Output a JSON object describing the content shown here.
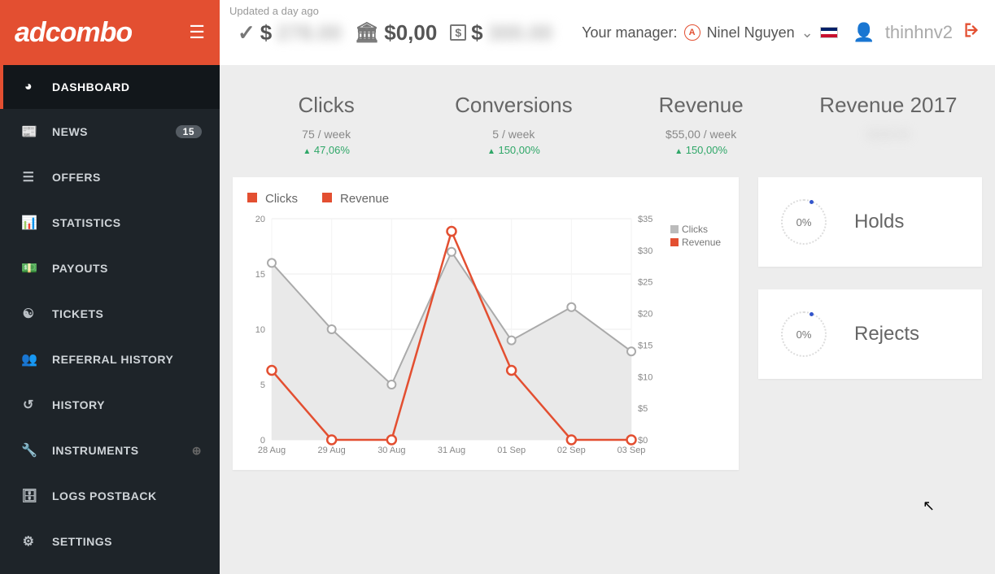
{
  "header": {
    "logo": "adcombo",
    "updated": "Updated a day ago",
    "balance1": "278.00",
    "balance2": "$0,00",
    "balance3": "300.00",
    "manager_label": "Your manager:",
    "manager_initial": "A",
    "manager_name": "Ninel Nguyen",
    "username": "thinhnv2"
  },
  "sidebar": {
    "items": [
      {
        "label": "DASHBOARD"
      },
      {
        "label": "NEWS",
        "badge": "15"
      },
      {
        "label": "OFFERS"
      },
      {
        "label": "STATISTICS"
      },
      {
        "label": "PAYOUTS"
      },
      {
        "label": "TICKETS"
      },
      {
        "label": "REFERRAL HISTORY"
      },
      {
        "label": "HISTORY"
      },
      {
        "label": "INSTRUMENTS"
      },
      {
        "label": "LOGS POSTBACK"
      },
      {
        "label": "SETTINGS"
      }
    ]
  },
  "stats": {
    "clicks": {
      "title": "Clicks",
      "sub": "75 / week",
      "pct": "47,06%"
    },
    "conversions": {
      "title": "Conversions",
      "sub": "5 / week",
      "pct": "150,00%"
    },
    "revenue": {
      "title": "Revenue",
      "sub": "$55,00 / week",
      "pct": "150,00%"
    },
    "revenue_year": {
      "title": "Revenue 2017",
      "value": "$190.00"
    }
  },
  "side_cards": {
    "holds": {
      "pct": "0%",
      "label": "Holds"
    },
    "rejects": {
      "pct": "0%",
      "label": "Rejects"
    }
  },
  "chart_legend": {
    "a": "Clicks",
    "b": "Revenue",
    "mini_a": "Clicks",
    "mini_b": "Revenue"
  },
  "chart_axes": {
    "y_left": [
      "20",
      "15",
      "10",
      "5",
      "0"
    ],
    "y_right": [
      "$35",
      "$30",
      "$25",
      "$20",
      "$15",
      "$10",
      "$5",
      "$0"
    ]
  },
  "chart_data": {
    "type": "line",
    "categories": [
      "28 Aug",
      "29 Aug",
      "30 Aug",
      "31 Aug",
      "01 Sep",
      "02 Sep",
      "03 Sep"
    ],
    "series": [
      {
        "name": "Clicks",
        "axis": "left",
        "values": [
          16,
          10,
          5,
          17,
          9,
          12,
          8
        ]
      },
      {
        "name": "Revenue",
        "axis": "right",
        "values": [
          11,
          0,
          0,
          33,
          11,
          0,
          0
        ]
      }
    ],
    "y_left_range": [
      0,
      20
    ],
    "y_right_range": [
      0,
      35
    ]
  }
}
